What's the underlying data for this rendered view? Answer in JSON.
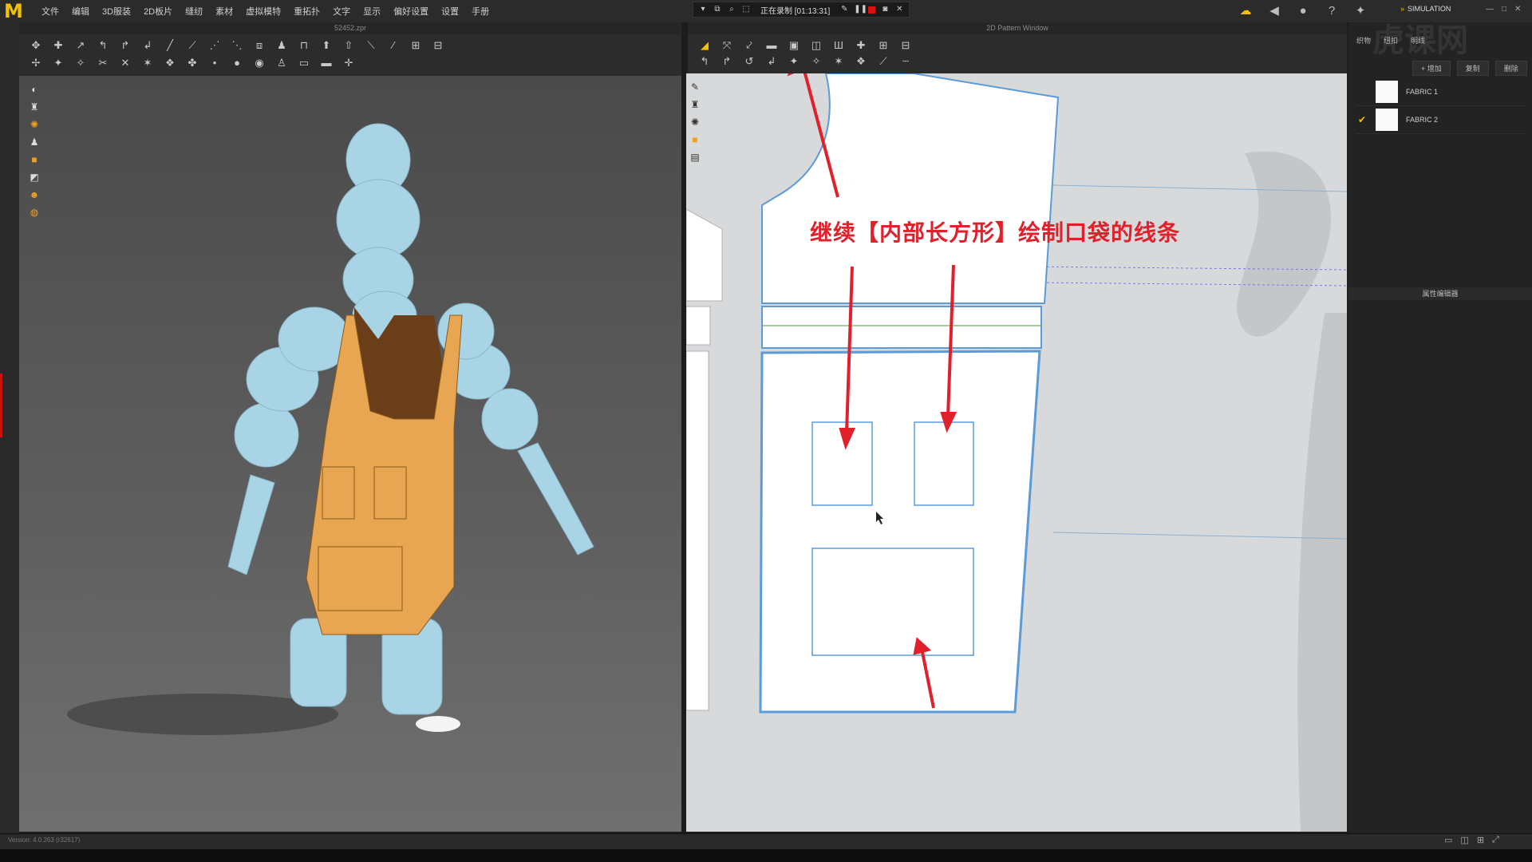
{
  "app": {
    "logo": "M"
  },
  "menu": [
    "文件",
    "编辑",
    "3D服装",
    "2D板片",
    "缝纫",
    "素材",
    "虚拟模特",
    "重拓扑",
    "文字",
    "显示",
    "偏好设置",
    "设置",
    "手册"
  ],
  "recording": {
    "status": "正在录制 [01:13:31]"
  },
  "sim_badge": "SIMULATION",
  "view3d": {
    "file_title": "52452.zpr"
  },
  "view2d": {
    "title": "2D Pattern Window"
  },
  "annotation": "继续【内部长方形】绘制口袋的线条",
  "right_panel": {
    "tabs": [
      "织物",
      "纽扣",
      "明线"
    ],
    "actions": [
      "+ 增加",
      "复制",
      "删除"
    ],
    "fabrics": [
      {
        "name": "FABRIC 1",
        "checked": false
      },
      {
        "name": "FABRIC 2",
        "checked": true
      }
    ],
    "property_header": "属性编辑器"
  },
  "status": {
    "version": "Version: 4.0.263 (r32617)"
  },
  "watermark": "虎课网",
  "colors": {
    "accent": "#f2c200",
    "annotation": "#e0202a",
    "pattern_line": "#5a9bd8",
    "apron": "#e8a552",
    "avatar": "#a9d4e6"
  }
}
